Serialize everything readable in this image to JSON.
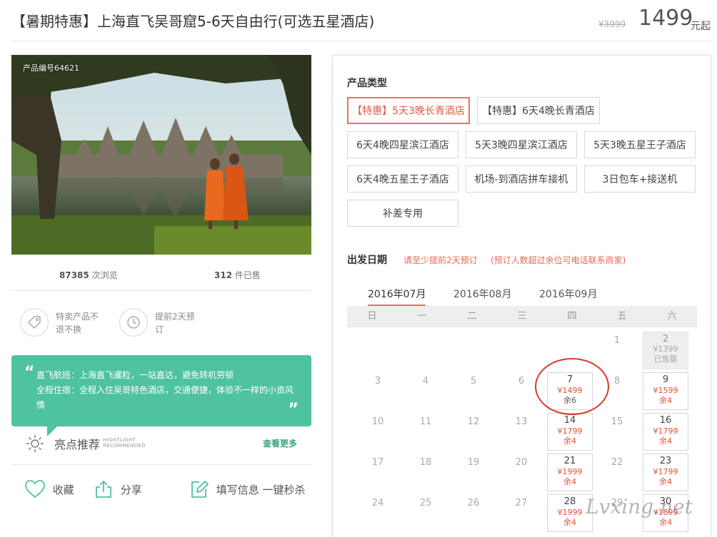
{
  "header": {
    "title": "【暑期特惠】上海直飞吴哥窟5-6天自由行(可选五星酒店)",
    "old_price": "¥3999",
    "price": "1499",
    "price_unit": "元起"
  },
  "photo": {
    "product_no": "产品编号64621"
  },
  "stats": {
    "views_count": "87385",
    "views_label": "次浏览",
    "sold_count": "312",
    "sold_label": "件已售"
  },
  "policies": [
    {
      "icon": "price-tag-icon",
      "line1": "特卖产品不",
      "line2": "退不换"
    },
    {
      "icon": "clock-history-icon",
      "line1": "提前2天预",
      "line2": "订"
    }
  ],
  "highlight": {
    "line1": "直飞航班：上海直飞暹粒，一站直达，避免转机劳顿",
    "line2": "全程住宿：全程入住吴哥特色酒店，交通便捷，体验不一样的小资风情",
    "title": "亮点推荐",
    "en_line1": "HIGHTLIGHT",
    "en_line2": "RECOMMENDED",
    "more": "查看更多"
  },
  "actions": {
    "favorite": "收藏",
    "share": "分享",
    "fill_info": "填写信息 一键秒杀"
  },
  "product_type": {
    "label": "产品类型",
    "options": [
      "【特惠】5天3晚长青酒店",
      "【特惠】6天4晚长青酒店",
      "6天4晚四星滨江酒店",
      "5天3晚四星滨江酒店",
      "5天3晚五星王子酒店",
      "6天4晚五星王子酒店",
      "机场-到酒店拼车接机",
      "3日包车+接送机",
      "补差专用"
    ],
    "selected_index": 0
  },
  "departure": {
    "label": "出发日期",
    "note1": "请至少提前2天预订",
    "note2": "(预订人数超过余位可电话联系商家)",
    "months": [
      "2016年07月",
      "2016年08月",
      "2016年09月"
    ],
    "active_month": 0,
    "weekdays": [
      "日",
      "一",
      "二",
      "三",
      "四",
      "五",
      "六"
    ],
    "days": {
      "d1": "1",
      "d2": "2",
      "d3": "3",
      "d4": "4",
      "d5": "5",
      "d6": "6",
      "d7": "7",
      "d8": "8",
      "d9": "9",
      "d10": "10",
      "d11": "11",
      "d12": "12",
      "d13": "13",
      "d14": "14",
      "d15": "15",
      "d16": "16",
      "d17": "17",
      "d18": "18",
      "d19": "19",
      "d20": "20",
      "d21": "21",
      "d22": "22",
      "d23": "23",
      "d24": "24",
      "d25": "25",
      "d26": "26",
      "d27": "27",
      "d28": "28",
      "d29": "29",
      "d30": "30"
    },
    "prices": {
      "d2": "¥1399",
      "d7": "¥1499",
      "d9": "¥1599",
      "d14": "¥1799",
      "d16": "¥1799",
      "d21": "¥1999",
      "d23": "¥1799",
      "d28": "¥1999",
      "d30": "¥1899"
    },
    "remain": {
      "d2": "已售罄",
      "d7": "余6",
      "d9": "余4",
      "d14": "余4",
      "d16": "余4",
      "d21": "余4",
      "d23": "余4",
      "d28": "余4",
      "d30": "余4"
    }
  },
  "watermark": "Lvxing.net",
  "colors": {
    "accent": "#e57560",
    "highlight_bg": "#4fc2a0",
    "price_red": "#e2503a",
    "circle_mark": "#d23c2a"
  }
}
